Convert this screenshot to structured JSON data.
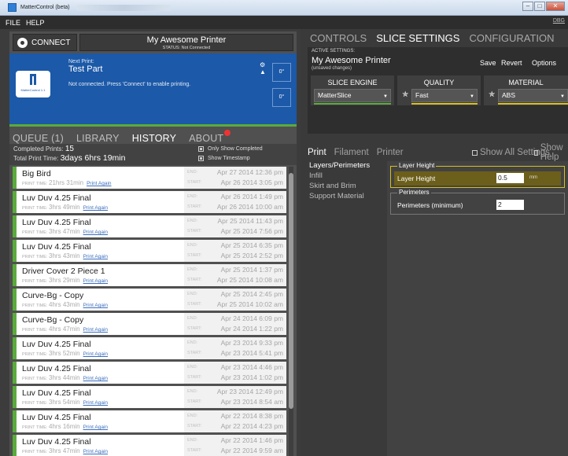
{
  "window": {
    "title": "MatterControl (beta)"
  },
  "menu": {
    "file": "FILE",
    "help": "HELP",
    "debug": "DBG"
  },
  "printer_bar": {
    "connect_label": "CONNECT",
    "printer_name": "My Awesome Printer",
    "status": "STATUS: Not Connected"
  },
  "next_print": {
    "label": "Next Print:",
    "name": "Test Part",
    "message": "Not connected. Press 'Connect' to enable printing.",
    "temp1": "0°",
    "temp2": "0°",
    "logo_text": "MatterControl 1.1"
  },
  "tabs": {
    "queue": "QUEUE (1)",
    "library": "LIBRARY",
    "history": "HISTORY",
    "about": "ABOUT"
  },
  "summary": {
    "completed_label": "Completed Prints:",
    "completed_value": "15",
    "total_label": "Total Print Time:",
    "total_value": "3days 6hrs 19min",
    "only_completed": "Only Show Completed",
    "show_timestamp": "Show Timestamp"
  },
  "history_labels": {
    "print_time": "PRINT TIME:",
    "print_again": "Print Again",
    "end": "END:",
    "start": "START:"
  },
  "history": [
    {
      "name": "Big Bird",
      "time": "21hrs 31min",
      "end": "Apr 27 2014 12:36 pm",
      "start": "Apr 26 2014 3:05 pm"
    },
    {
      "name": "Luv Duv 4.25 Final",
      "time": "3hrs 49min",
      "end": "Apr 26 2014 1:49 pm",
      "start": "Apr 26 2014 10:00 am"
    },
    {
      "name": "Luv Duv 4.25 Final",
      "time": "3hrs 47min",
      "end": "Apr 25 2014 11:43 pm",
      "start": "Apr 25 2014 7:56 pm"
    },
    {
      "name": "Luv Duv 4.25 Final",
      "time": "3hrs 43min",
      "end": "Apr 25 2014 6:35 pm",
      "start": "Apr 25 2014 2:52 pm"
    },
    {
      "name": "Driver Cover 2 Piece 1",
      "time": "3hrs 29min",
      "end": "Apr 25 2014 1:37 pm",
      "start": "Apr 25 2014 10:08 am"
    },
    {
      "name": "Curve-Bg - Copy",
      "time": "4hrs 43min",
      "end": "Apr 25 2014 2:45 pm",
      "start": "Apr 25 2014 10:02 am"
    },
    {
      "name": "Curve-Bg - Copy",
      "time": "4hrs 47min",
      "end": "Apr 24 2014 6:09 pm",
      "start": "Apr 24 2014 1:22 pm"
    },
    {
      "name": "Luv Duv 4.25 Final",
      "time": "3hrs 52min",
      "end": "Apr 23 2014 9:33 pm",
      "start": "Apr 23 2014 5:41 pm"
    },
    {
      "name": "Luv Duv 4.25 Final",
      "time": "3hrs 44min",
      "end": "Apr 23 2014 4:46 pm",
      "start": "Apr 23 2014 1:02 pm"
    },
    {
      "name": "Luv Duv 4.25 Final",
      "time": "3hrs 54min",
      "end": "Apr 23 2014 12:49 pm",
      "start": "Apr 23 2014 8:54 am"
    },
    {
      "name": "Luv Duv 4.25 Final",
      "time": "4hrs 16min",
      "end": "Apr 22 2014 8:38 pm",
      "start": "Apr 22 2014 4:23 pm"
    },
    {
      "name": "Luv Duv 4.25 Final",
      "time": "3hrs 47min",
      "end": "Apr 22 2014 1:46 pm",
      "start": "Apr 22 2014 9:59 am"
    }
  ],
  "right_tabs": {
    "controls": "CONTROLS",
    "slice": "SLICE SETTINGS",
    "config": "CONFIGURATION"
  },
  "active_settings": {
    "label": "ACTIVE SETTINGS:",
    "name": "My Awesome Printer",
    "unsaved": "(unsaved changes)",
    "save": "Save",
    "revert": "Revert",
    "options": "Options"
  },
  "engines": [
    {
      "header": "SLICE ENGINE",
      "value": "MatterSlice"
    },
    {
      "header": "QUALITY",
      "value": "Fast"
    },
    {
      "header": "MATERIAL",
      "value": "ABS"
    }
  ],
  "sub_tabs": {
    "print": "Print",
    "filament": "Filament",
    "printer": "Printer",
    "show_all": "Show All Settings",
    "show_help": "Show Help"
  },
  "categories": [
    "Layers/Perimeters",
    "Infill",
    "Skirt and Brim",
    "Support Material"
  ],
  "groups": {
    "layer_height": {
      "title": "Layer Height",
      "field": "Layer Height",
      "value": "0.5",
      "unit": "mm"
    },
    "perimeters": {
      "title": "Perimeters",
      "field": "Perimeters (minimum)",
      "value": "2"
    }
  },
  "colors": {
    "accent_blue": "#1c59a8",
    "ok_green": "#5aab3b",
    "warn_yellow": "#d7bf1f"
  }
}
